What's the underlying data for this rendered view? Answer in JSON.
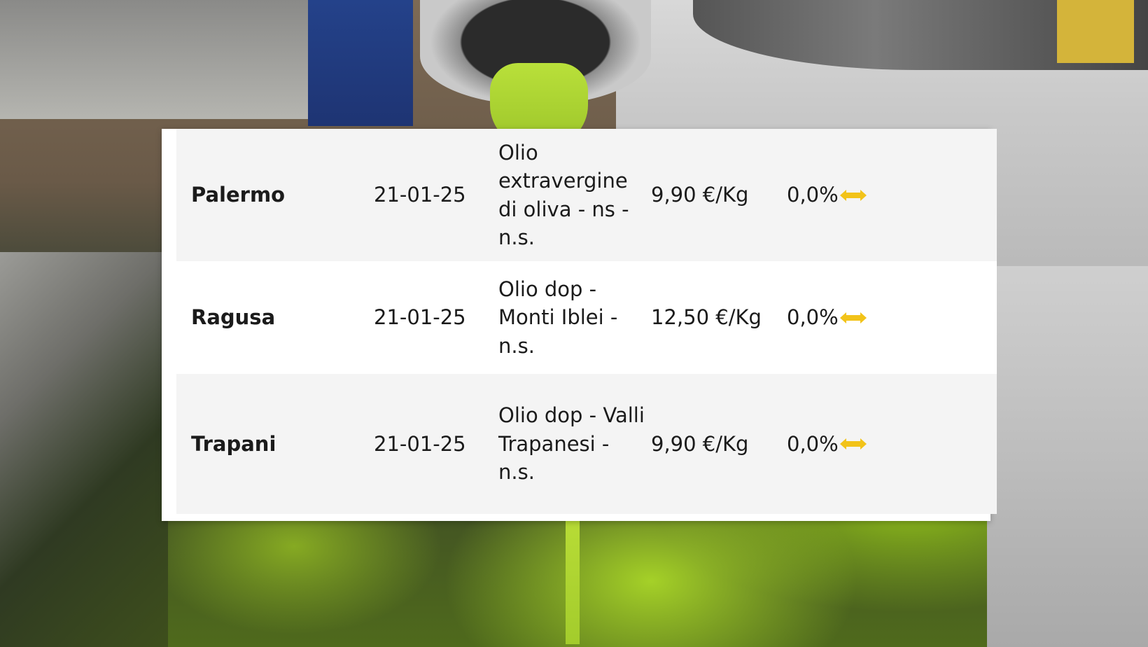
{
  "table": {
    "rows": [
      {
        "city": "Palermo",
        "date": "21-01-25",
        "product": "Olio extravergine di oliva - ns - n.s.",
        "price": "9,90 €/Kg",
        "variation": "0,0%",
        "trend_icon": "left-right-arrow-icon"
      },
      {
        "city": "Ragusa",
        "date": "21-01-25",
        "product": "Olio dop - Monti Iblei - n.s.",
        "price": "12,50 €/Kg",
        "variation": "0,0%",
        "trend_icon": "left-right-arrow-icon"
      },
      {
        "city": "Trapani",
        "date": "21-01-25",
        "product": "Olio dop - Valli Trapanesi - n.s.",
        "price": "9,90 €/Kg",
        "variation": "0,0%",
        "trend_icon": "left-right-arrow-icon"
      }
    ]
  },
  "colors": {
    "arrow": "#f2c319",
    "row_alt": "#f4f4f4",
    "text": "#1b1b1b"
  }
}
